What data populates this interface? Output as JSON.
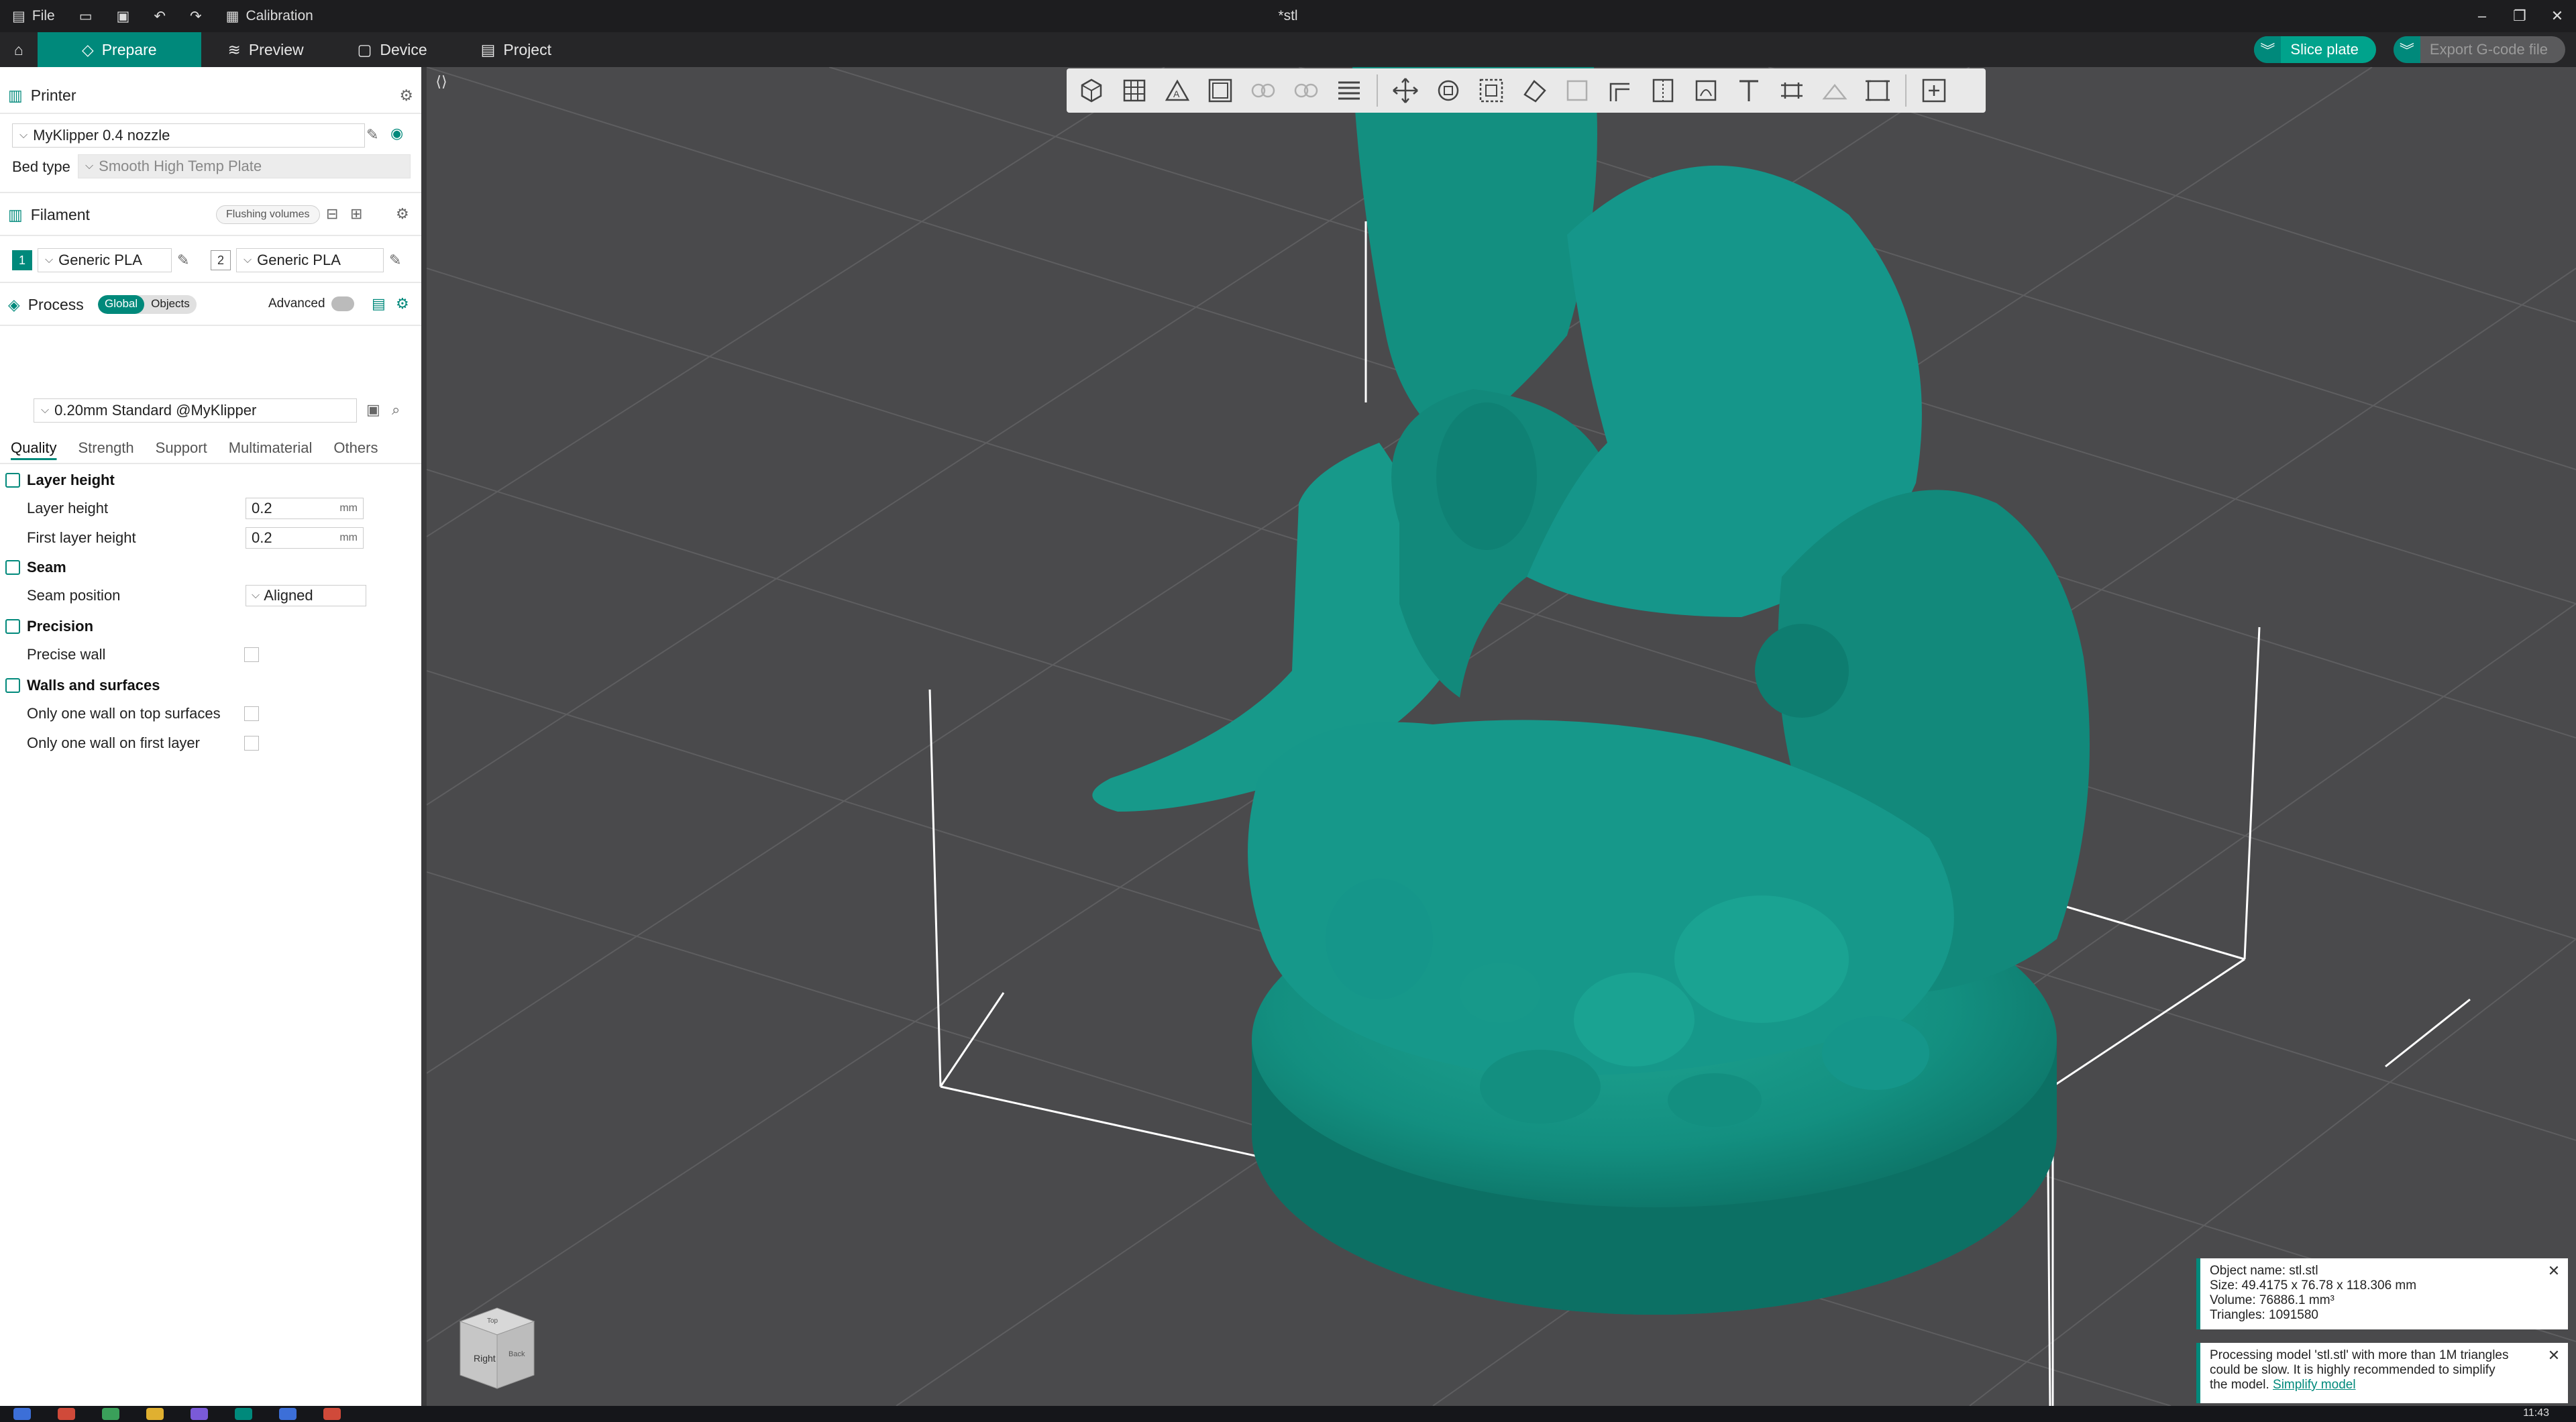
{
  "titlebar": {
    "file": "File",
    "calibration": "Calibration",
    "title": "*stl"
  },
  "menubar": {
    "tabs": [
      {
        "label": "Prepare"
      },
      {
        "label": "Preview"
      },
      {
        "label": "Device"
      },
      {
        "label": "Project"
      }
    ],
    "slice": "Slice plate",
    "export": "Export G-code file"
  },
  "printer": {
    "header": "Printer",
    "name": "MyKlipper 0.4 nozzle",
    "bed_type_label": "Bed type",
    "bed_type": "Smooth High Temp Plate"
  },
  "filament": {
    "header": "Filament",
    "flushing": "Flushing volumes",
    "items": [
      {
        "index": "1",
        "name": "Generic PLA",
        "color": "#00897b"
      },
      {
        "index": "2",
        "name": "Generic PLA",
        "color": "#ffffff"
      }
    ]
  },
  "process": {
    "header": "Process",
    "global": "Global",
    "objects": "Objects",
    "advanced": "Advanced",
    "preset": "0.20mm Standard @MyKlipper",
    "tabs": [
      "Quality",
      "Strength",
      "Support",
      "Multimaterial",
      "Others"
    ],
    "groups": {
      "layer_height": "Layer height",
      "seam": "Seam",
      "precision": "Precision",
      "walls": "Walls and surfaces"
    },
    "rows": {
      "layer_height": {
        "label": "Layer height",
        "value": "0.2",
        "unit": "mm"
      },
      "first_layer_height": {
        "label": "First layer height",
        "value": "0.2",
        "unit": "mm"
      },
      "seam_position": {
        "label": "Seam position",
        "value": "Aligned"
      },
      "precise_wall": {
        "label": "Precise wall"
      },
      "one_wall_top": {
        "label": "Only one wall on top surfaces"
      },
      "one_wall_first": {
        "label": "Only one wall on first layer"
      }
    }
  },
  "notices": {
    "object_info": {
      "line1": "Object name: stl.stl",
      "line2": "Size: 49.4175 x 76.78 x 118.306 mm",
      "line3": "Volume: 76886.1 mm³",
      "line4": "Triangles: 1091580"
    },
    "warning": {
      "line1": "Processing model 'stl.stl' with more than 1M triangles",
      "line2": "could be slow. It is highly recommended to simplify",
      "line3": "the model.",
      "link": "Simplify model"
    }
  },
  "navcube": {
    "front": "Right",
    "side": "Back",
    "top": "Top"
  },
  "taskbar": {
    "clock": "11:43"
  },
  "colors": {
    "accent": "#00897b",
    "model": "#138f80",
    "viewport_bg": "#4a4a4c"
  }
}
